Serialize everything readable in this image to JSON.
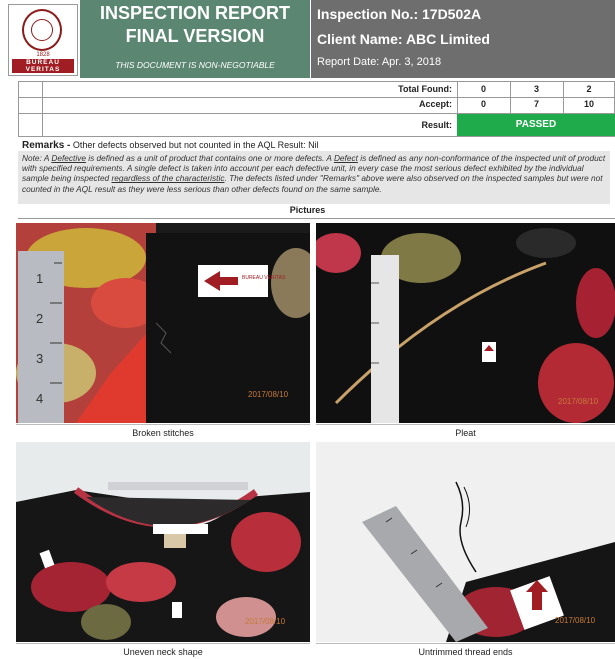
{
  "header": {
    "logo_year": "1828",
    "brand_line1": "BUREAU",
    "brand_line2": "VERITAS",
    "title_line1": "INSPECTION REPORT",
    "title_line2": "FINAL VERSION",
    "disclaimer": "THIS DOCUMENT IS NON-NEGOTIABLE",
    "inspection_no": "Inspection No.: 17D502A",
    "client_name": "Client Name: ABC Limited",
    "report_date": "Report Date: Apr. 3, 2018"
  },
  "results": {
    "total_found_label": "Total Found:",
    "accept_label": "Accept:",
    "result_label": "Result:",
    "total_found": [
      "0",
      "3",
      "2"
    ],
    "accept": [
      "0",
      "7",
      "10"
    ],
    "result": "PASSED"
  },
  "remarks": {
    "label": "Remarks -",
    "text": "Other defects observed but not counted in the AQL Result: Nil"
  },
  "note": {
    "p1": "Note: A ",
    "t1": "Defective",
    "p2": " is defined as a unit of product that contains one or more defects. A ",
    "t2": "Defect",
    "p3": " is defined as any non-conformance of the inspected unit of product with specified requirements.  A single defect is taken into account per each defective unit, in every case the most serious defect exhibited by the individual sample being inspected ",
    "t3": "regardless of the characteristic",
    "p4": ". The defects listed under \"Remarks\" above were also observed on the inspected samples but were not counted in the AQL result as they were less serious than other defects found on the same sample."
  },
  "pictures": {
    "title": "Pictures",
    "captions": [
      "Broken stitches",
      "Pleat",
      "Uneven neck shape",
      "Untrimmed thread ends"
    ],
    "date_stamp": "2017/08/10",
    "ruler_marks": [
      "1",
      "2",
      "3",
      "4"
    ],
    "tag_brand": "BUREAU VERITAS"
  },
  "colors": {
    "title_green": "#5b8671",
    "info_gray": "#6e6e6e",
    "brand_red": "#a01e23",
    "passed_green": "#1faa4c",
    "note_gray": "#e6e6e6"
  }
}
